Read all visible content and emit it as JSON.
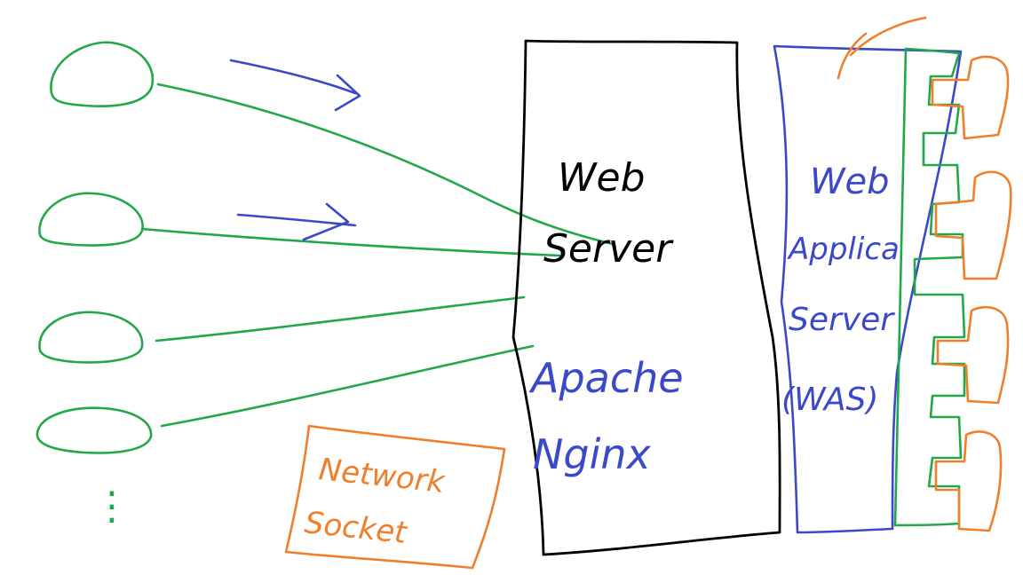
{
  "colors": {
    "client": "#22a84a",
    "web_server_box": "#000000",
    "was_box": "#3b49c9",
    "network_socket": "#f07f2c",
    "flow_arrow": "#3b49c9"
  },
  "web_server": {
    "line1": "Web",
    "line2": "Server",
    "examples": [
      "Apache",
      "Nginx"
    ]
  },
  "was": {
    "line1": "Web",
    "line2": "Applica",
    "line3": "Server",
    "line4": "(WAS)"
  },
  "network_socket": {
    "line1": "Network",
    "line2": "Socket"
  },
  "clients": {
    "count_shown": 4,
    "ellipsis": "⋮"
  },
  "plugins": {
    "count_shown": 4
  }
}
